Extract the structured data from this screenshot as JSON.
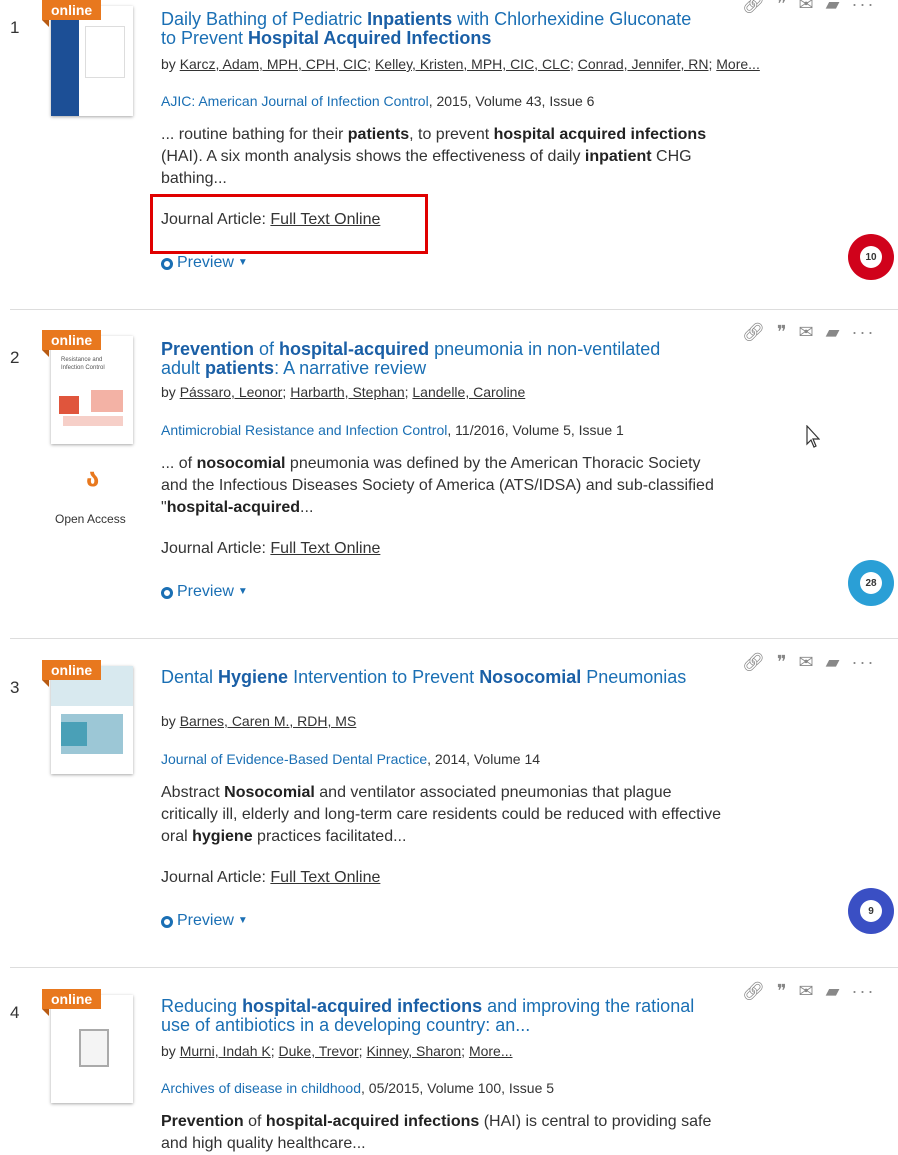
{
  "results": [
    {
      "number": "1",
      "badge": "online",
      "title_parts": [
        [
          "Daily Bathing of Pediatric ",
          false
        ],
        [
          "Inpatients",
          true
        ],
        [
          " with Chlorhexidine Gluconate to Prevent ",
          false
        ],
        [
          "Hospital Acquired Infections",
          true
        ]
      ],
      "authors_prefix": "by ",
      "authors": [
        "Karcz, Adam, MPH, CPH, CIC",
        "Kelley, Kristen, MPH, CIC, CLC",
        "Conrad, Jennifer, RN",
        "More..."
      ],
      "journal": "AJIC: American Journal of Infection Control",
      "source_rest": ", 2015, Volume 43, Issue 6",
      "snippet_parts": [
        [
          "... routine bathing for their ",
          false
        ],
        [
          "patients",
          true
        ],
        [
          ", to prevent ",
          false
        ],
        [
          "hospital acquired infections",
          true
        ],
        [
          " (HAI). A six month analysis shows the effectiveness of daily ",
          false
        ],
        [
          "inpatient",
          true
        ],
        [
          " CHG bathing...",
          false
        ]
      ],
      "format_label": "Journal Article: ",
      "format_link": "Full Text Online",
      "preview": "Preview",
      "altmetric": "10",
      "altmetric_color": "#d0021b"
    },
    {
      "number": "2",
      "badge": "online",
      "title_parts": [
        [
          "Prevention",
          true
        ],
        [
          " of ",
          false
        ],
        [
          "hospital-acquired",
          true
        ],
        [
          " pneumonia in non-ventilated adult ",
          false
        ],
        [
          "patients",
          true
        ],
        [
          ": A narrative review",
          false
        ]
      ],
      "authors_prefix": "by ",
      "authors": [
        "Pássaro, Leonor",
        "Harbarth, Stephan",
        "Landelle, Caroline"
      ],
      "journal": "Antimicrobial Resistance and Infection Control",
      "source_rest": ", 11/2016, Volume 5, Issue 1",
      "snippet_parts": [
        [
          "... of ",
          false
        ],
        [
          "nosocomial",
          true
        ],
        [
          " pneumonia was defined by the American Thoracic Society and the Infectious Diseases Society of America (ATS/IDSA) and sub-classified \"",
          false
        ],
        [
          "hospital-acquired",
          true
        ],
        [
          "...",
          false
        ]
      ],
      "format_label": "Journal Article: ",
      "format_link": "Full Text Online",
      "preview": "Preview",
      "altmetric": "28",
      "altmetric_color": "#2a9fd6",
      "open_access": "Open Access"
    },
    {
      "number": "3",
      "badge": "online",
      "title_parts": [
        [
          "Dental ",
          false
        ],
        [
          "Hygiene",
          true
        ],
        [
          " Intervention to Prevent ",
          false
        ],
        [
          "Nosocomial",
          true
        ],
        [
          " Pneumonias",
          false
        ]
      ],
      "authors_prefix": "by ",
      "authors": [
        "Barnes, Caren M., RDH, MS"
      ],
      "journal": "Journal of Evidence-Based Dental Practice",
      "source_rest": ", 2014, Volume 14",
      "snippet_parts": [
        [
          "Abstract ",
          false
        ],
        [
          "Nosocomial",
          true
        ],
        [
          " and ventilator associated pneumonias that plague critically ill, elderly and long-term care residents could be reduced with effective oral ",
          false
        ],
        [
          "hygiene",
          true
        ],
        [
          " practices facilitated...",
          false
        ]
      ],
      "format_label": "Journal Article: ",
      "format_link": "Full Text Online",
      "preview": "Preview",
      "altmetric": "9",
      "altmetric_color": "#3a4fc4"
    },
    {
      "number": "4",
      "badge": "online",
      "title_parts": [
        [
          "Reducing ",
          false
        ],
        [
          "hospital-acquired infections",
          true
        ],
        [
          " and improving the rational use of antibiotics in a developing country: an...",
          false
        ]
      ],
      "authors_prefix": "by ",
      "authors": [
        "Murni, Indah K",
        "Duke, Trevor",
        "Kinney, Sharon",
        "More..."
      ],
      "journal": "Archives of disease in childhood",
      "source_rest": ", 05/2015, Volume 100, Issue 5",
      "snippet_parts": [
        [
          "Prevention",
          true
        ],
        [
          " of ",
          false
        ],
        [
          "hospital-acquired infections",
          true
        ],
        [
          " (HAI) is central to providing safe and high quality healthcare...",
          false
        ]
      ]
    }
  ]
}
